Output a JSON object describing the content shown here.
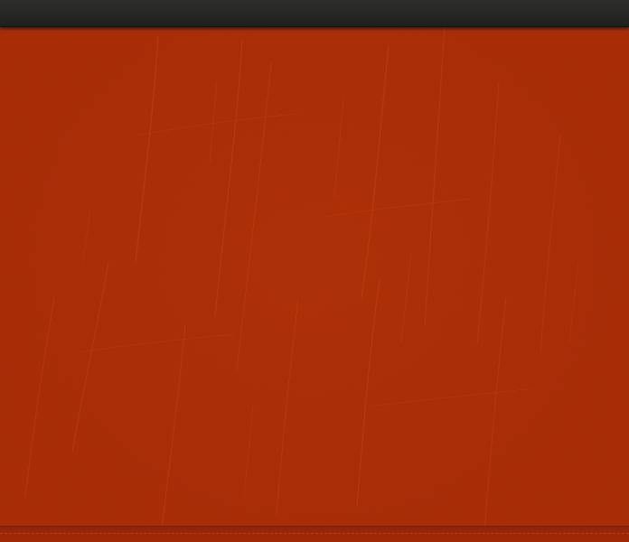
{
  "window": {
    "title": ""
  },
  "colors": {
    "top_bar": "#262624",
    "leather": "#ab2b08",
    "leather_scratch": "#d24a18",
    "bottom_strip": "#9a2707",
    "stitch": "#d25a32"
  },
  "top_bar": {
    "label": ""
  },
  "panel": {
    "texture": "red-leather-scratched"
  }
}
